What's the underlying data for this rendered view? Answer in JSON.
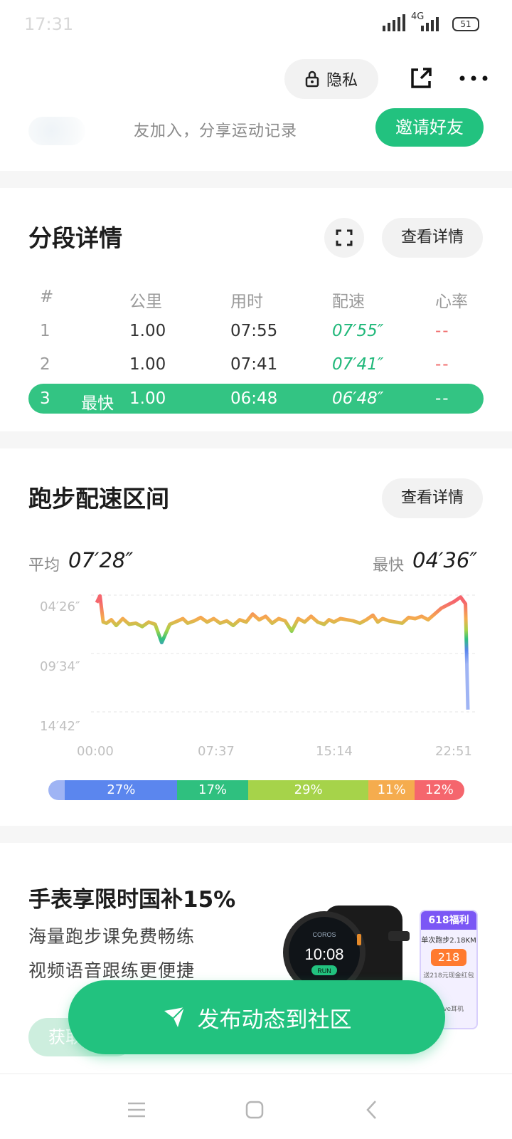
{
  "status_bar": {
    "time": "17:31",
    "network": "4G",
    "battery": "51"
  },
  "topbar": {
    "privacy_label": "隐私",
    "share_icon": "share-icon",
    "more_icon": "more-icon"
  },
  "invite": {
    "text": "友加入，分享运动记录",
    "button_label": "邀请好友"
  },
  "splits": {
    "title": "分段详情",
    "detail_button": "查看详情",
    "headers": [
      "#",
      "公里",
      "用时",
      "配速",
      "心率"
    ],
    "rows": [
      {
        "num": "1",
        "tag": "",
        "km": "1.00",
        "time": "07:55",
        "pace": "07′55″",
        "hr": "--"
      },
      {
        "num": "2",
        "tag": "",
        "km": "1.00",
        "time": "07:41",
        "pace": "07′41″",
        "hr": "--"
      },
      {
        "num": "3",
        "tag": "最快",
        "km": "1.00",
        "time": "06:48",
        "pace": "06′48″",
        "hr": "--"
      }
    ]
  },
  "pace_section": {
    "title": "跑步配速区间",
    "detail_button": "查看详情",
    "avg_label": "平均",
    "avg_value": "07′28″",
    "fast_label": "最快",
    "fast_value": "04′36″"
  },
  "chart_data": {
    "type": "area",
    "title": "",
    "xlabel": "",
    "ylabel": "",
    "y_axis": "pace (min′sec″ per km), inverted: faster at top",
    "y_tick_labels": [
      "04′26″",
      "09′34″",
      "14′42″"
    ],
    "x_tick_labels": [
      "00:00",
      "07:37",
      "15:14",
      "22:51"
    ],
    "x_range": [
      "00:00",
      "22:51"
    ],
    "y_range": [
      "04′26″",
      "14′42″"
    ],
    "grid": true,
    "series": [
      {
        "x_minutes": [
          0,
          0.2,
          0.4,
          0.6,
          0.9,
          1.2,
          1.6,
          2.0,
          2.4,
          2.8,
          3.2,
          3.6,
          4.0,
          4.5,
          5.0,
          5.3,
          5.6,
          6.0,
          6.4,
          6.8,
          7.2,
          7.6,
          8.0,
          8.4,
          8.8,
          9.2,
          9.6,
          10.0,
          10.4,
          10.8,
          11.2,
          11.6,
          12.0,
          12.4,
          12.8,
          13.2,
          13.6,
          14.0,
          14.3,
          14.6,
          15.0,
          15.4,
          15.8,
          16.2,
          16.6,
          17.0,
          17.3,
          17.6,
          18.0,
          18.4,
          18.8,
          19.2,
          19.6,
          20.0,
          20.4,
          20.8,
          21.2,
          21.6,
          22.0,
          22.4,
          22.7,
          22.85
        ],
        "pace_minutes": [
          5.1,
          4.5,
          6.8,
          6.9,
          6.6,
          7.1,
          6.5,
          7.0,
          6.9,
          7.2,
          6.8,
          7.0,
          8.6,
          7.0,
          6.7,
          6.5,
          6.9,
          6.7,
          6.4,
          6.8,
          6.5,
          6.9,
          6.7,
          7.1,
          6.6,
          6.8,
          6.1,
          6.6,
          6.3,
          6.9,
          6.5,
          6.7,
          7.6,
          6.5,
          6.8,
          6.3,
          6.8,
          7.0,
          6.6,
          6.8,
          6.5,
          6.6,
          6.7,
          6.9,
          6.6,
          6.2,
          6.8,
          6.5,
          6.7,
          6.8,
          6.9,
          6.4,
          6.5,
          6.3,
          6.6,
          6.1,
          5.6,
          5.3,
          5.0,
          4.6,
          5.2,
          14.5
        ]
      }
    ],
    "zone_distribution": [
      {
        "label": "",
        "percent": 4,
        "color": "#9fb4f4"
      },
      {
        "label": "27%",
        "percent": 27,
        "color": "#5b86ee"
      },
      {
        "label": "17%",
        "percent": 17,
        "color": "#2fc07f"
      },
      {
        "label": "29%",
        "percent": 29,
        "color": "#a6d34a"
      },
      {
        "label": "11%",
        "percent": 11,
        "color": "#f5ac4e"
      },
      {
        "label": "12%",
        "percent": 12,
        "color": "#f5666d"
      }
    ]
  },
  "promo": {
    "title": "手表享限时国补15%",
    "line1": "海量跑步课免费畅练",
    "line2": "视频语音跟练更便捷",
    "get_button": "获取",
    "watch_time": "10:08",
    "watch_brand": "COROS",
    "watch_mode": "RUN",
    "card_badge": "618福利",
    "card_text": "单次跑步2.18KM",
    "card_amount": "218",
    "card_sub": "送218元现金红包",
    "card_footer": "Move耳机"
  },
  "fab": {
    "label": "发布动态到社区"
  },
  "colors": {
    "accent": "#22c27f",
    "pace_green": "#20b87a",
    "hr_red": "#f06a6a"
  }
}
